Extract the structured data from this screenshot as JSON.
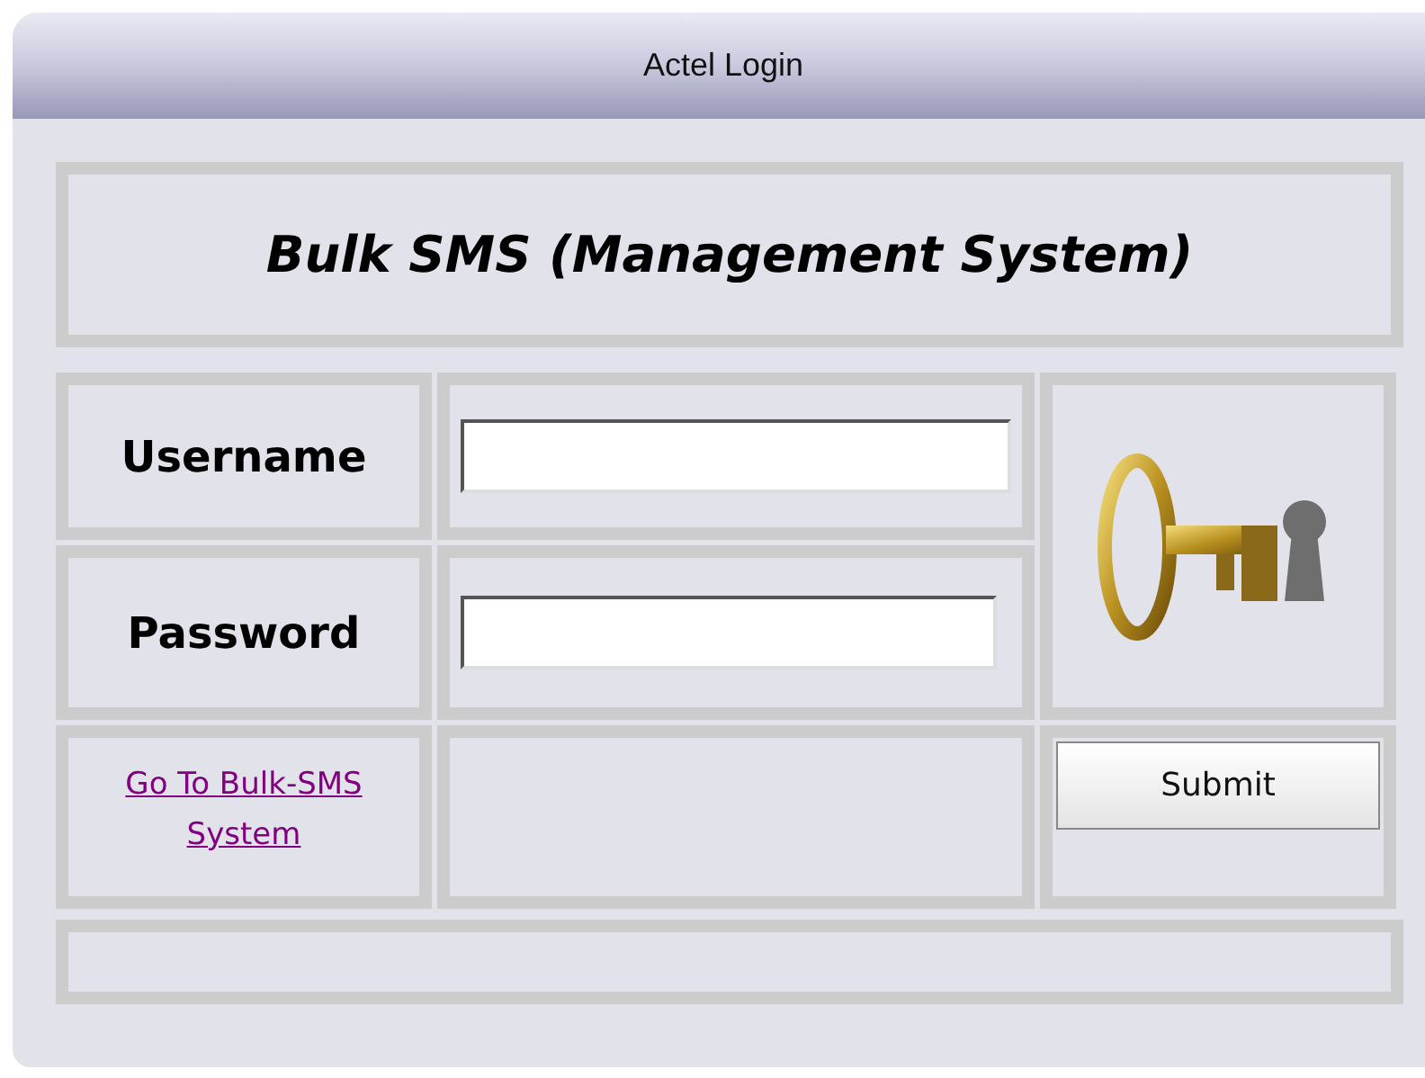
{
  "window": {
    "title": "Actel Login"
  },
  "heading": "Bulk SMS (Management System)",
  "fields": [
    {
      "label": "Username"
    },
    {
      "label": "Password"
    }
  ],
  "link": "Go To Bulk-SMS System",
  "submit": "Submit"
}
